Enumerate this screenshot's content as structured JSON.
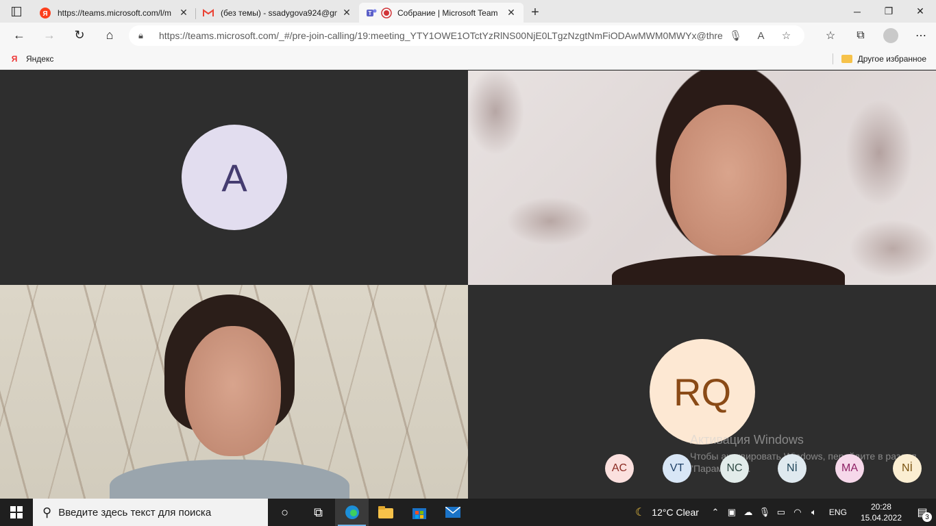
{
  "browser": {
    "tabs": [
      {
        "title": "https://teams.microsoft.com/l/m",
        "favicon": "yandex-icon",
        "active": false
      },
      {
        "title": "(без темы) - ssadygova924@gm",
        "favicon": "gmail-icon",
        "active": false
      },
      {
        "title": "Собрание | Microsoft Team",
        "favicon": "teams-icon",
        "active": true
      }
    ],
    "address": "https://teams.microsoft.com/_#/pre-join-calling/19:meeting_YTY1OWE1OTctYzRlNS00NjE0LTgzNzgtNmFiODAwMWM0MWYx@thre...",
    "bookmarks": {
      "left": "Яндекс",
      "right": "Другое избранное"
    }
  },
  "meeting": {
    "tiles": [
      {
        "initials": "A",
        "kind": "avatar"
      },
      {
        "kind": "video"
      },
      {
        "kind": "video"
      },
      {
        "initials": "RQ",
        "kind": "avatar"
      }
    ],
    "overflow_participants": [
      {
        "initials": "AC",
        "bg": "#fbe0de",
        "fg": "#8b2a22"
      },
      {
        "initials": "VT",
        "bg": "#d8e6f6",
        "fg": "#1e3f66"
      },
      {
        "initials": "NC",
        "bg": "#e2ecea",
        "fg": "#2f4a44"
      },
      {
        "initials": "Nİ",
        "bg": "#dfe9ef",
        "fg": "#20465a"
      },
      {
        "initials": "MA",
        "bg": "#f6d8ea",
        "fg": "#8e2165"
      },
      {
        "initials": "Nİ",
        "bg": "#fbeed2",
        "fg": "#7a5310"
      }
    ],
    "watermark": {
      "title": "Активация Windows",
      "subtitle": "Чтобы активировать Windows, перейдите в раздел \"Параметры\"."
    }
  },
  "taskbar": {
    "search_placeholder": "Введите здесь текст для поиска",
    "weather": "12°C  Clear",
    "language": "ENG",
    "time": "20:28",
    "date": "15.04.2022",
    "notifications": "3"
  }
}
